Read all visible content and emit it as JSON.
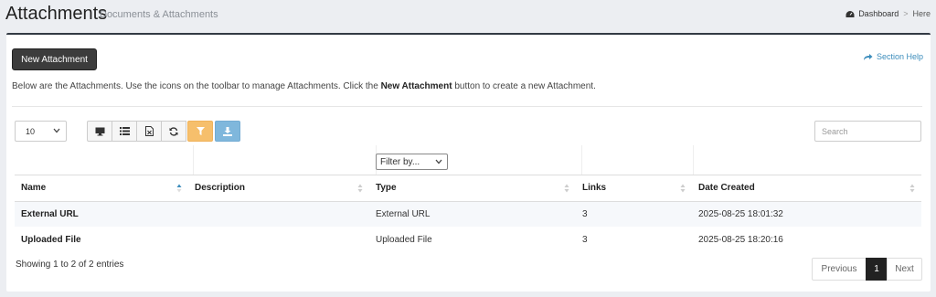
{
  "header": {
    "title": "Attachments",
    "subtitle": "Documents & Attachments",
    "breadcrumb": {
      "dashboard": "Dashboard",
      "separator": ">",
      "current": "Here"
    }
  },
  "actions": {
    "new_button": "New Attachment",
    "section_help": "Section Help"
  },
  "intro": {
    "before": "Below are the Attachments. Use the icons on the toolbar to manage Attachments. Click the ",
    "strong": "New Attachment",
    "after": " button to create a new Attachment."
  },
  "controls": {
    "page_length": "10",
    "toolbar_icons": [
      "monitor-icon",
      "list-icon",
      "export-file-icon",
      "refresh-icon",
      "filter-icon",
      "download-icon"
    ],
    "search_placeholder": "Search",
    "filter_placeholder": "Filter by..."
  },
  "colors": {
    "filter_button": "#f6bf6c",
    "download_button": "#7fb7dc",
    "primary": "#3c3c3c",
    "link": "#3c8dbc"
  },
  "table": {
    "columns": [
      "Name",
      "Description",
      "Type",
      "Links",
      "Date Created"
    ],
    "rows": [
      {
        "name": "External URL",
        "description": "",
        "type": "External URL",
        "links": "3",
        "date_created": "2025-08-25 18:01:32"
      },
      {
        "name": "Uploaded File",
        "description": "",
        "type": "Uploaded File",
        "links": "3",
        "date_created": "2025-08-25 18:20:16"
      }
    ]
  },
  "footer": {
    "info": "Showing 1 to 2 of 2 entries",
    "pagination": {
      "previous": "Previous",
      "current": "1",
      "next": "Next"
    }
  }
}
